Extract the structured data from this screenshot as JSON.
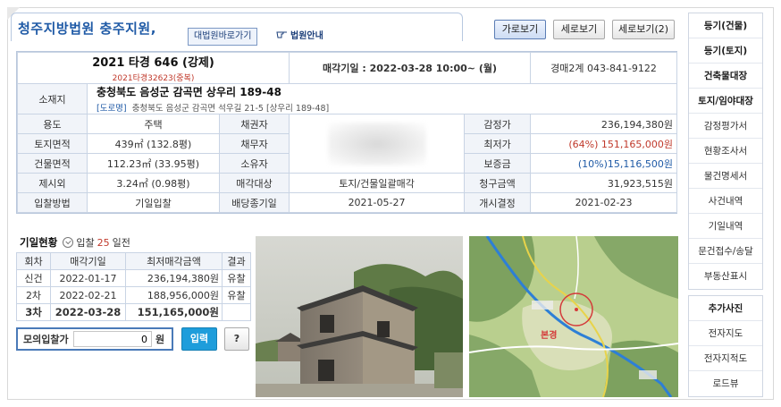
{
  "header": {
    "court_name": "청주지방법원 충주지원,",
    "supreme_button": "대법원바로가기",
    "guide_button": "법원안내",
    "view_buttons": [
      "가로보기",
      "세로보기",
      "세로보기(2)"
    ]
  },
  "case": {
    "case_no": "2021 타경 646 (강제)",
    "case_sub": "2021타경32623(중복)",
    "sale_date": "매각기일 : 2022-03-28 10:00~ (월)",
    "dept": "경매2계 043-841-9122"
  },
  "location": {
    "label": "소재지",
    "address": "충청북도 음성군 감곡면 상우리 189-48",
    "road_tag": "[도로명]",
    "road_address": "충청북도 음성군 감곡면 석우길 21-5 [상우리 189-48]"
  },
  "rows": [
    {
      "l1": "용도",
      "v1": "주택",
      "l2": "채권자",
      "v2": "",
      "l3": "감정가",
      "v3": "236,194,380원"
    },
    {
      "l1": "토지면적",
      "v1": "439㎡ (132.8평)",
      "l2": "채무자",
      "v2": "",
      "l3": "최저가",
      "v3": "(64%) 151,165,000원"
    },
    {
      "l1": "건물면적",
      "v1": "112.23㎡ (33.95평)",
      "l2": "소유자",
      "v2": "",
      "l3": "보증금",
      "v3": "(10%)15,116,500원"
    },
    {
      "l1": "제시외",
      "v1": "3.24㎡ (0.98평)",
      "l2": "매각대상",
      "v2": "토지/건물일괄매각",
      "l3": "청구금액",
      "v3": "31,923,515원"
    },
    {
      "l1": "입찰방법",
      "v1": "기일입찰",
      "l2": "배당종기일",
      "v2": "2021-05-27",
      "l3": "개시결정",
      "v3": "2021-02-23"
    }
  ],
  "history": {
    "title": "기일현황",
    "sub_prefix": "입찰",
    "sub_days": "25",
    "sub_suffix": "일전",
    "headers": [
      "회차",
      "매각기일",
      "최저매각금액",
      "결과"
    ],
    "rows": [
      {
        "round": "신건",
        "date": "2022-01-17",
        "amount": "236,194,380원",
        "result": "유찰"
      },
      {
        "round": "2차",
        "date": "2022-02-21",
        "amount": "188,956,000원",
        "result": "유찰"
      },
      {
        "round": "3차",
        "date": "2022-03-28",
        "amount": "151,165,000원",
        "result": ""
      }
    ]
  },
  "mock_bid": {
    "label": "모의입찰가",
    "value": "0",
    "unit": "원",
    "enter": "입력",
    "help": "?"
  },
  "map": {
    "place_label": "본경"
  },
  "sidebar": {
    "group1": [
      "등기(건물)",
      "등기(토지)",
      "건축물대장",
      "토지/임야대장",
      "감정평가서",
      "현황조사서",
      "물건명세서",
      "사건내역",
      "기일내역",
      "문건접수/송달",
      "부동산표시"
    ],
    "group2": [
      "추가사진",
      "전자지도",
      "전자지적도",
      "로드뷰"
    ]
  }
}
